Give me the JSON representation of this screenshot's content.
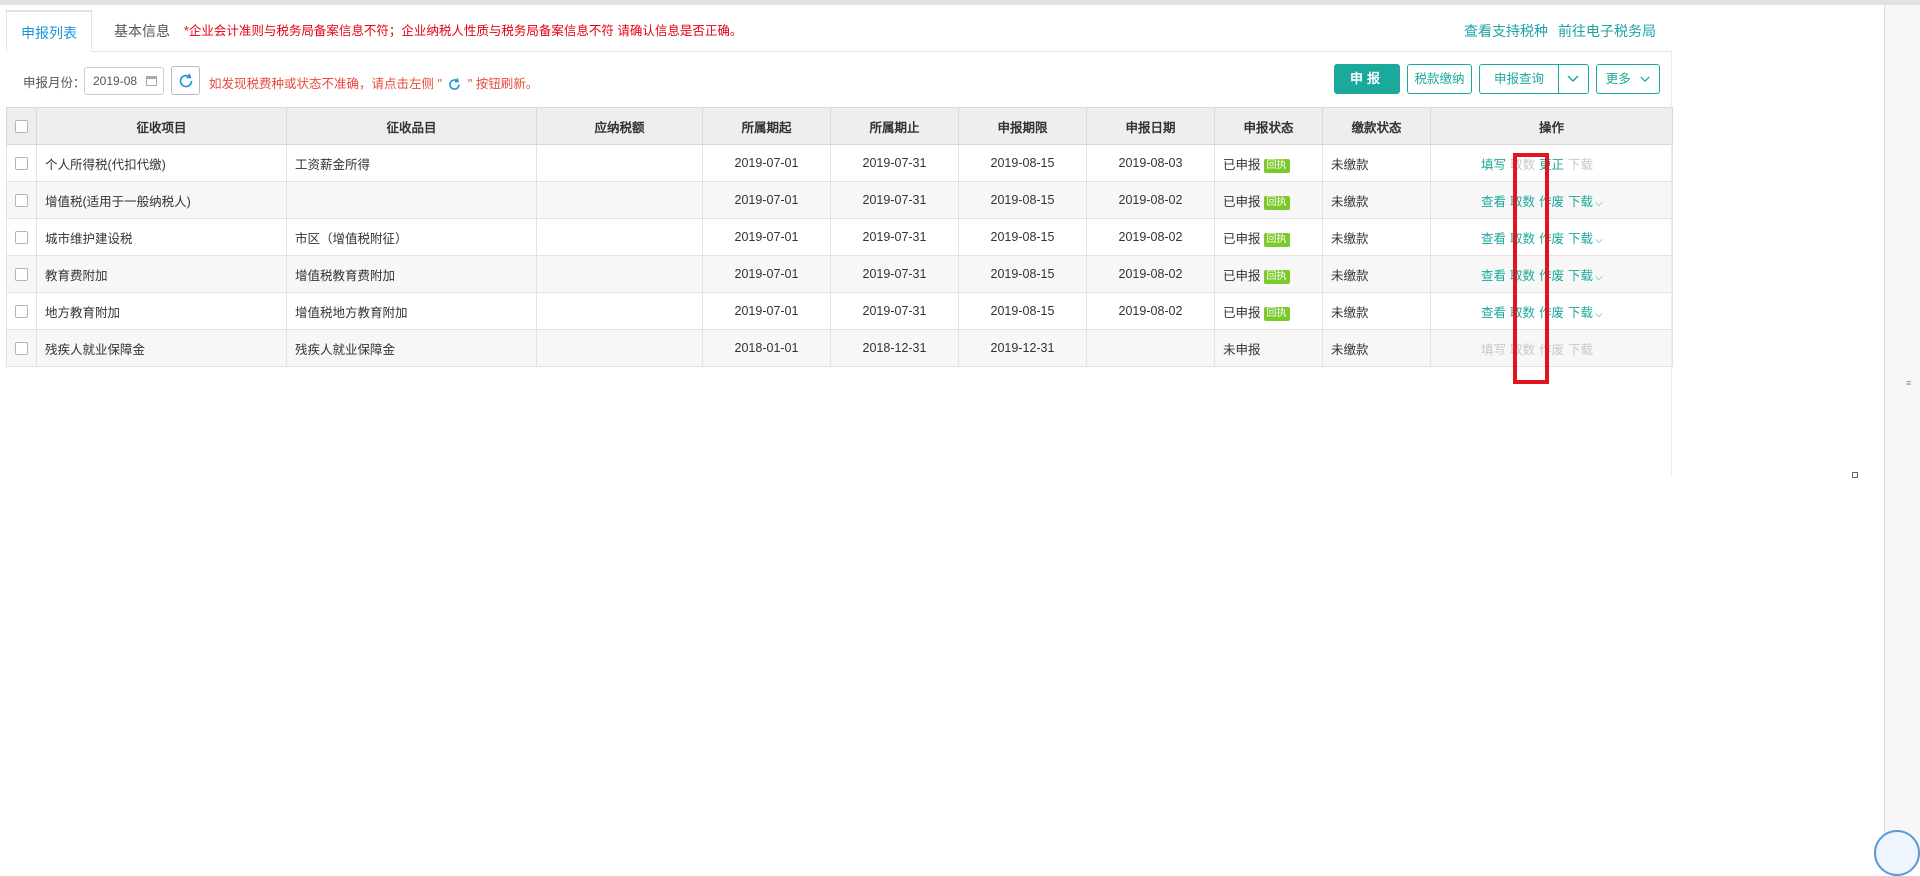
{
  "tabs": [
    {
      "label": "申报列表",
      "active": true
    },
    {
      "label": "基本信息",
      "active": false
    }
  ],
  "warning_text": "*企业会计准则与税务局备案信息不符；企业纳税人性质与税务局备案信息不符 请确认信息是否正确。",
  "top_links": {
    "supported_taxes": "查看支持税种",
    "e_tax_bureau": "前往电子税务局"
  },
  "toolbar": {
    "month_label": "申报月份：",
    "month_value": "2019-08",
    "tip_before": "如发现税费种或状态不准确，请点击左侧 \"",
    "tip_after": "\" 按钮刷新。",
    "declare": "申报",
    "tax_payment": "税款缴纳",
    "declare_query": "申报查询",
    "more": "更多"
  },
  "table": {
    "columns": [
      "征收项目",
      "征收品目",
      "应纳税额",
      "所属期起",
      "所属期止",
      "申报期限",
      "申报日期",
      "申报状态",
      "缴款状态",
      "操作"
    ],
    "rows": [
      {
        "item": "个人所得税(代扣代缴)",
        "sub_item": "工资薪金所得",
        "amount": "",
        "start": "2019-07-01",
        "end": "2019-07-31",
        "deadline": "2019-08-15",
        "date": "2019-08-03",
        "status": "已申报",
        "receipt": "回执",
        "payment": "未缴款",
        "ops": [
          {
            "label": "填写",
            "enabled": true
          },
          {
            "label": "取数",
            "enabled": false
          },
          {
            "label": "更正",
            "enabled": true
          },
          {
            "label": "下载",
            "enabled": false
          }
        ]
      },
      {
        "item": "增值税(适用于一般纳税人)",
        "sub_item": "",
        "amount": "",
        "start": "2019-07-01",
        "end": "2019-07-31",
        "deadline": "2019-08-15",
        "date": "2019-08-02",
        "status": "已申报",
        "receipt": "回执",
        "payment": "未缴款",
        "ops": [
          {
            "label": "查看",
            "enabled": true
          },
          {
            "label": "取数",
            "enabled": true
          },
          {
            "label": "作废",
            "enabled": true
          },
          {
            "label": "下载",
            "enabled": true,
            "dropdown": true
          }
        ]
      },
      {
        "item": "城市维护建设税",
        "sub_item": "市区（增值税附征）",
        "amount": "",
        "start": "2019-07-01",
        "end": "2019-07-31",
        "deadline": "2019-08-15",
        "date": "2019-08-02",
        "status": "已申报",
        "receipt": "回执",
        "payment": "未缴款",
        "ops": [
          {
            "label": "查看",
            "enabled": true
          },
          {
            "label": "取数",
            "enabled": true
          },
          {
            "label": "作废",
            "enabled": true
          },
          {
            "label": "下载",
            "enabled": true,
            "dropdown": true
          }
        ]
      },
      {
        "item": "教育费附加",
        "sub_item": "增值税教育费附加",
        "amount": "",
        "start": "2019-07-01",
        "end": "2019-07-31",
        "deadline": "2019-08-15",
        "date": "2019-08-02",
        "status": "已申报",
        "receipt": "回执",
        "payment": "未缴款",
        "ops": [
          {
            "label": "查看",
            "enabled": true
          },
          {
            "label": "取数",
            "enabled": true
          },
          {
            "label": "作废",
            "enabled": true
          },
          {
            "label": "下载",
            "enabled": true,
            "dropdown": true
          }
        ]
      },
      {
        "item": "地方教育附加",
        "sub_item": "增值税地方教育附加",
        "amount": "",
        "start": "2019-07-01",
        "end": "2019-07-31",
        "deadline": "2019-08-15",
        "date": "2019-08-02",
        "status": "已申报",
        "receipt": "回执",
        "payment": "未缴款",
        "ops": [
          {
            "label": "查看",
            "enabled": true
          },
          {
            "label": "取数",
            "enabled": true
          },
          {
            "label": "作废",
            "enabled": true
          },
          {
            "label": "下载",
            "enabled": true,
            "dropdown": true
          }
        ]
      },
      {
        "item": "残疾人就业保障金",
        "sub_item": "残疾人就业保障金",
        "amount": "",
        "start": "2018-01-01",
        "end": "2018-12-31",
        "deadline": "2019-12-31",
        "date": "",
        "status": "未申报",
        "receipt": "",
        "payment": "未缴款",
        "ops": [
          {
            "label": "填写",
            "enabled": false
          },
          {
            "label": "取数",
            "enabled": false
          },
          {
            "label": "作废",
            "enabled": false
          },
          {
            "label": "下载",
            "enabled": false
          }
        ]
      }
    ]
  },
  "colors": {
    "accent": "#1ba99b",
    "tab_active": "#1a94d6",
    "warning": "#e60012",
    "badge": "#7cc92c",
    "highlight": "#e3141f"
  }
}
